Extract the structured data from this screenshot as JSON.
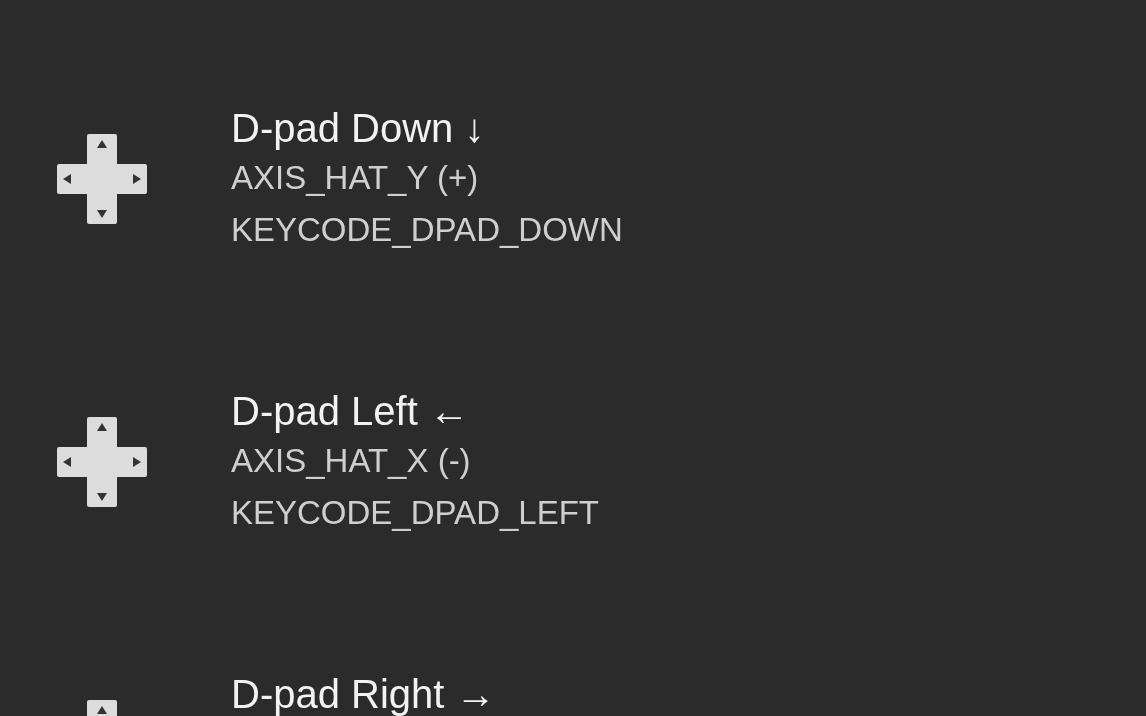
{
  "mappings": [
    {
      "title": "D-pad Down ↓",
      "lines": [
        "AXIS_HAT_Y (+)",
        "KEYCODE_DPAD_DOWN"
      ]
    },
    {
      "title": "D-pad Left ←",
      "lines": [
        "AXIS_HAT_X (-)",
        "KEYCODE_DPAD_LEFT"
      ]
    },
    {
      "title": "D-pad Right →"
    }
  ]
}
